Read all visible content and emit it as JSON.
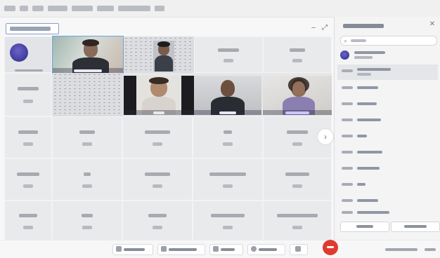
{
  "app": {
    "menu_items": [
      "",
      "",
      "",
      "",
      "",
      "",
      "",
      ""
    ],
    "view_selector_label": ""
  },
  "gallery": {
    "self_tile": {
      "name": "",
      "avatar": "user-avatar"
    },
    "video_tiles": [
      {
        "name": "",
        "pinned": true
      },
      {
        "name": "",
        "pinned": false
      },
      {
        "name": "",
        "pinned": false
      },
      {
        "name": "",
        "pinned": false
      },
      {
        "name": "",
        "pinned": false
      }
    ],
    "name_tiles": [
      {
        "name": ""
      },
      {
        "name": ""
      },
      {
        "name": ""
      },
      {
        "name": ""
      },
      {
        "name": ""
      },
      {
        "name": ""
      },
      {
        "name": ""
      },
      {
        "name": ""
      },
      {
        "name": ""
      },
      {
        "name": ""
      },
      {
        "name": ""
      },
      {
        "name": ""
      },
      {
        "name": ""
      },
      {
        "name": ""
      },
      {
        "name": ""
      },
      {
        "name": ""
      },
      {
        "name": ""
      },
      {
        "name": ""
      }
    ]
  },
  "participants_panel": {
    "title": "",
    "search_placeholder": "",
    "rows": [
      {
        "name": "",
        "selected": false,
        "has_avatar": true
      },
      {
        "name": "",
        "selected": true,
        "has_avatar": false
      },
      {
        "name": "",
        "selected": false,
        "has_avatar": false
      },
      {
        "name": "",
        "selected": false,
        "has_avatar": false
      },
      {
        "name": "",
        "selected": false,
        "has_avatar": false
      },
      {
        "name": "",
        "selected": false,
        "has_avatar": false
      },
      {
        "name": "",
        "selected": false,
        "has_avatar": false
      },
      {
        "name": "",
        "selected": false,
        "has_avatar": false
      },
      {
        "name": "",
        "selected": false,
        "has_avatar": false
      },
      {
        "name": "",
        "selected": false,
        "has_avatar": false
      },
      {
        "name": "",
        "selected": false,
        "has_avatar": false
      }
    ],
    "buttons": [
      "",
      ""
    ]
  },
  "toolbar": {
    "buttons": [
      "",
      "",
      "",
      ""
    ],
    "right_labels": [
      "",
      ""
    ]
  },
  "colors": {
    "accent": "#69a7d8",
    "leave_button": "#e03a2f",
    "avatar": "#3b36a6"
  }
}
